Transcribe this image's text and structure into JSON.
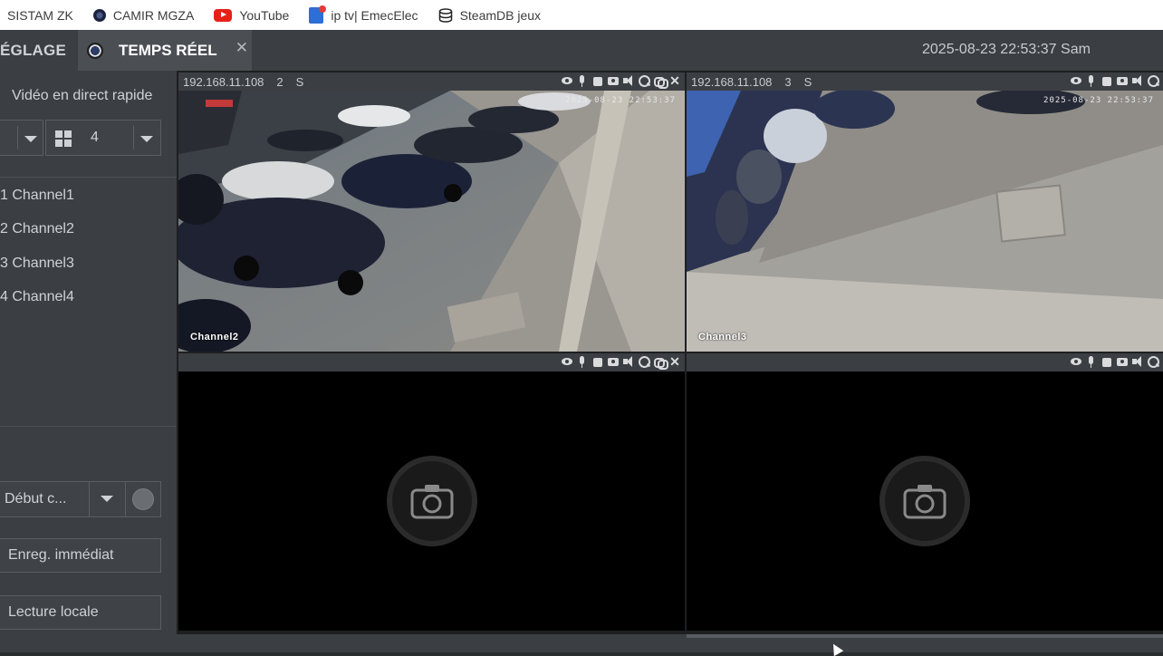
{
  "bookmarks": [
    {
      "label": "SISTAM ZK",
      "icon": "none"
    },
    {
      "label": "CAMIR MGZA",
      "icon": "camir-icon"
    },
    {
      "label": "YouTube",
      "icon": "youtube-icon"
    },
    {
      "label": "ip tv| EmecElec",
      "icon": "iptv-icon"
    },
    {
      "label": "SteamDB jeux",
      "icon": "steamdb-icon"
    }
  ],
  "appbar": {
    "tab_settings": "ÉGLAGE",
    "tab_live": "TEMPS RÉEL",
    "close_glyph": "✕",
    "datetime": "2025-08-23 22:53:37 Sam"
  },
  "sidebar": {
    "title": "Vidéo en direct rapide",
    "layout_value": "4",
    "channels": [
      "1 Channel1",
      "2 Channel2",
      "3 Channel3",
      "4 Channel4"
    ],
    "record_select": "Début c...",
    "btn_record_now": "Enreg. immédiat",
    "btn_local_playback": "Lecture locale"
  },
  "cells": [
    {
      "ip": "192.168.11.108",
      "num": "2",
      "stream": "S",
      "osd_label": "Channel2",
      "osd_time": "2025-08-23 22:53:37"
    },
    {
      "ip": "192.168.11.108",
      "num": "3",
      "stream": "S",
      "osd_label": "Channel3",
      "osd_time": "2025-08-23 22:53:37"
    },
    {
      "ip": "",
      "num": "",
      "stream": "",
      "osd_label": "",
      "osd_time": ""
    },
    {
      "ip": "",
      "num": "",
      "stream": "",
      "osd_label": "",
      "osd_time": ""
    }
  ],
  "colors": {
    "panel": "#3b3e42",
    "active_tab": "#4b4f54",
    "text": "#cfd2d5",
    "video_bg": "#000000"
  }
}
